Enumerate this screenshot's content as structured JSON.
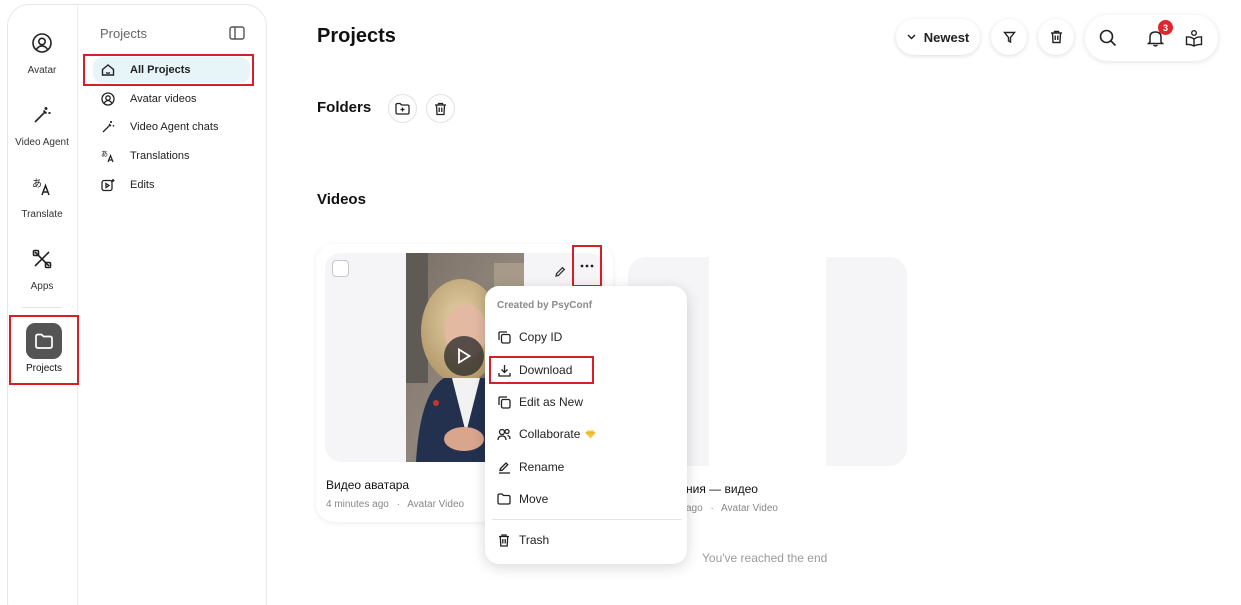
{
  "rail": {
    "avatar": "Avatar",
    "video_agent": "Video Agent",
    "translate": "Translate",
    "apps": "Apps",
    "projects": "Projects"
  },
  "nav": {
    "title": "Projects",
    "items": [
      {
        "label": "All Projects",
        "icon": "home-icon"
      },
      {
        "label": "Avatar videos",
        "icon": "avatar-circle-icon"
      },
      {
        "label": "Video Agent chats",
        "icon": "magic-wand-icon"
      },
      {
        "label": "Translations",
        "icon": "translate-icon"
      },
      {
        "label": "Edits",
        "icon": "video-edit-icon"
      }
    ]
  },
  "header": {
    "title": "Projects",
    "sort_label": "Newest",
    "notification_count": "3"
  },
  "sections": {
    "folders": "Folders",
    "videos": "Videos"
  },
  "videos": [
    {
      "title": "Видео аватара",
      "time": "4 minutes ago",
      "type": "Avatar Video"
    },
    {
      "title": "ния — видео",
      "time": "ago",
      "type": "Avatar Video"
    }
  ],
  "end_text": "You've reached the end",
  "menu": {
    "header": "Created by PsyConf",
    "items": [
      "Copy ID",
      "Download",
      "Edit as New",
      "Collaborate",
      "Rename",
      "Move",
      "Trash"
    ]
  },
  "colors": {
    "highlight_red": "#d61f26",
    "active_nav_bg": "#e7f4f8",
    "badge_red": "#e0252c",
    "projects_tile": "#545454"
  }
}
